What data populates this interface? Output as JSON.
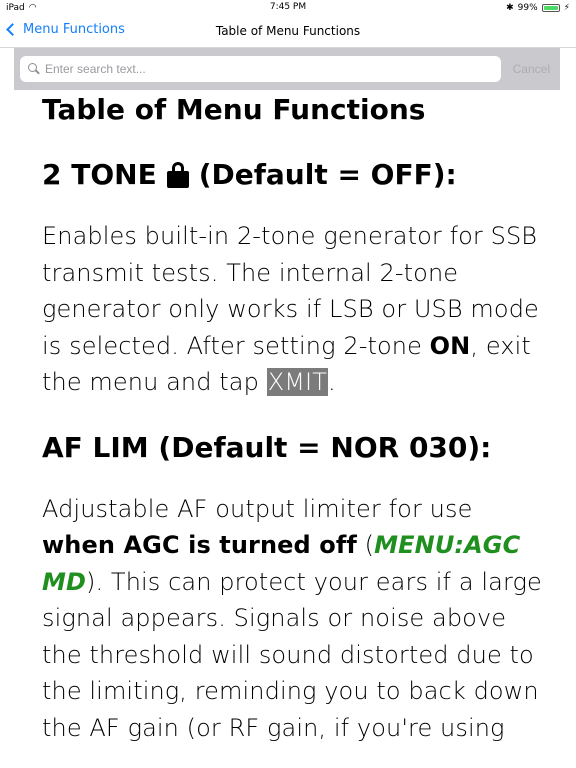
{
  "status_bar": {
    "device": "iPad",
    "time": "7:45 PM",
    "battery_percent": "99%",
    "battery_level": 0.99
  },
  "nav": {
    "back_label": "Menu Functions",
    "title": "Table of Menu Functions"
  },
  "search": {
    "placeholder": "Enter search text...",
    "value": "",
    "cancel_label": "Cancel"
  },
  "content": {
    "page_title": "Table of Menu Functions",
    "section1": {
      "heading_pre": "2 TONE",
      "heading_post": "(Default = OFF):",
      "p_part1": "Enables built-in 2-tone generator for SSB transmit tests. The internal 2-tone generator only works if LSB or USB mode is selected. After setting 2-tone ",
      "p_on": "ON",
      "p_part2": ", exit the menu and tap ",
      "p_xmit": "XMIT",
      "p_part3": "."
    },
    "section2": {
      "heading": "AF LIM (Default = NOR 030):",
      "p_part1": "Adjustable AF output limiter for use ",
      "p_bold": "when AGC is turned off",
      "p_part2": " (",
      "p_link": "MENU:AGC MD",
      "p_part3": "). This can protect your ears if a large signal appears. Signals or noise above the threshold will sound distorted due to the limiting, reminding you to back down the AF gain (or RF gain, if you're using"
    }
  },
  "colors": {
    "accent": "#147efb",
    "link_green": "#1f8f1f",
    "highlight_bg": "#7b7b7b"
  }
}
